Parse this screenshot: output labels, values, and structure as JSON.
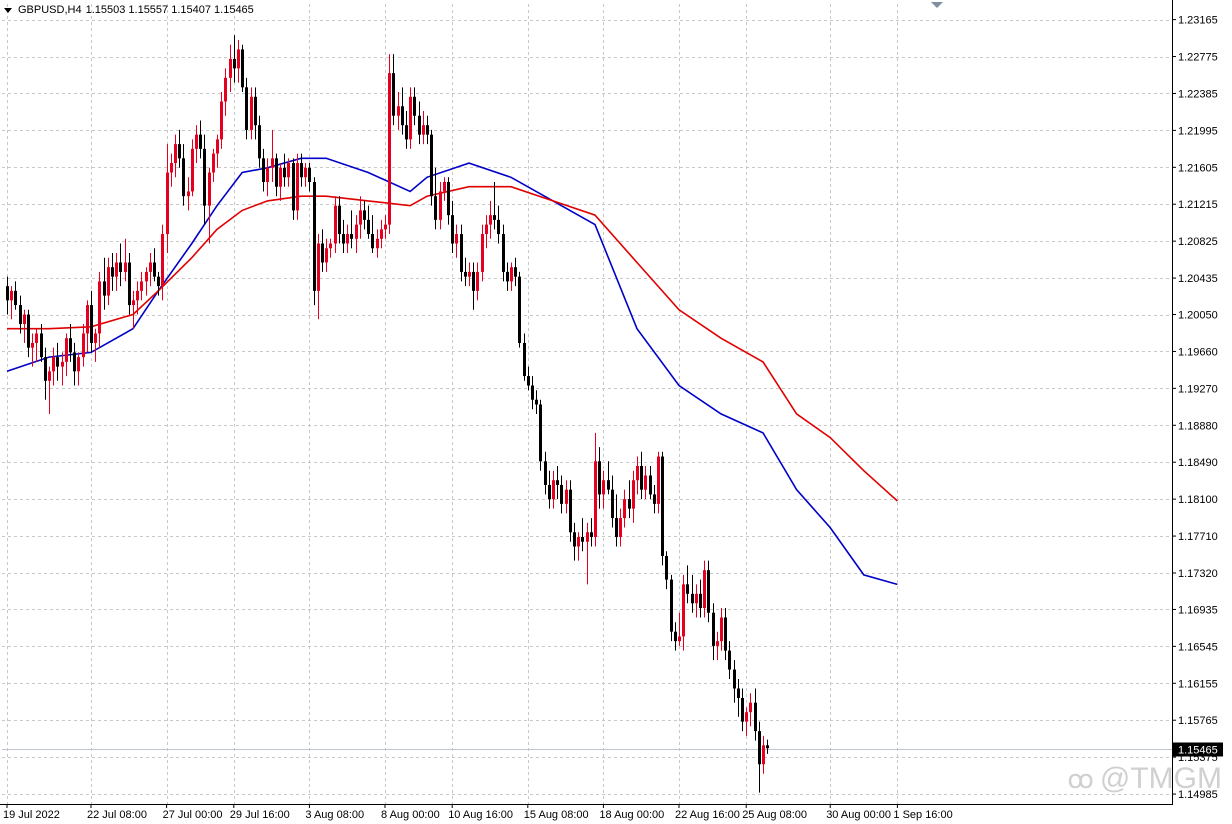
{
  "symbol_header": {
    "symbol": "GBPUSD,H4",
    "ohlc": "1.15503 1.15557 1.15407 1.15465"
  },
  "current_price_label": "1.15465",
  "watermark": {
    "icon": "tmgm-logo-icon",
    "text": "@TMGM"
  },
  "colors": {
    "bull": "#e6001f",
    "bear": "#000000",
    "ma_fast": "#0000c8",
    "ma_slow": "#e00000",
    "grid": "#c8c8c8",
    "price_line": "#bfc6d1"
  },
  "chart_data": {
    "type": "candlestick",
    "timeframe": "H4",
    "y_ticks": [
      1.23165,
      1.22775,
      1.22385,
      1.21995,
      1.21605,
      1.21215,
      1.20825,
      1.20435,
      1.2005,
      1.1966,
      1.1927,
      1.1888,
      1.1849,
      1.181,
      1.1771,
      1.1732,
      1.16935,
      1.16545,
      1.16155,
      1.15765,
      1.15375,
      1.14985
    ],
    "y_tick_labels": [
      "1.23165",
      "1.22775",
      "1.22385",
      "1.21995",
      "1.21605",
      "1.21215",
      "1.20825",
      "1.20435",
      "1.20050",
      "1.19660",
      "1.19270",
      "1.18880",
      "1.18490",
      "1.18100",
      "1.17710",
      "1.17320",
      "1.16935",
      "1.16545",
      "1.16155",
      "1.15765",
      "1.15375",
      "1.14985"
    ],
    "ylim": [
      1.1488,
      1.2333
    ],
    "x_labels": [
      {
        "label": "19 Jul 2022",
        "bar": 0
      },
      {
        "label": "22 Jul 08:00",
        "bar": 20
      },
      {
        "label": "27 Jul 00:00",
        "bar": 38
      },
      {
        "label": "29 Jul 16:00",
        "bar": 54
      },
      {
        "label": "3 Aug 08:00",
        "bar": 72
      },
      {
        "label": "8 Aug 00:00",
        "bar": 90
      },
      {
        "label": "10 Aug 16:00",
        "bar": 106
      },
      {
        "label": "15 Aug 08:00",
        "bar": 124
      },
      {
        "label": "18 Aug 00:00",
        "bar": 142
      },
      {
        "label": "22 Aug 16:00",
        "bar": 160
      },
      {
        "label": "25 Aug 08:00",
        "bar": 176
      },
      {
        "label": "30 Aug 00:00",
        "bar": 196
      },
      {
        "label": "1 Sep 16:00",
        "bar": 212
      }
    ],
    "grid": true,
    "last_price": 1.15465,
    "candles_ohlc": [
      [
        1.2035,
        1.2045,
        1.2005,
        1.202
      ],
      [
        1.202,
        1.2035,
        1.2,
        1.203
      ],
      [
        1.203,
        1.204,
        1.201,
        1.2015
      ],
      [
        1.2015,
        1.2025,
        1.1985,
        1.1995
      ],
      [
        1.1995,
        1.201,
        1.1975,
        1.2005
      ],
      [
        1.2005,
        1.201,
        1.196,
        1.197
      ],
      [
        1.197,
        1.1985,
        1.195,
        1.1975
      ],
      [
        1.1975,
        1.199,
        1.1955,
        1.1985
      ],
      [
        1.1985,
        1.1995,
        1.1955,
        1.196
      ],
      [
        1.196,
        1.197,
        1.1915,
        1.1935
      ],
      [
        1.1935,
        1.195,
        1.19,
        1.1945
      ],
      [
        1.1945,
        1.197,
        1.193,
        1.196
      ],
      [
        1.196,
        1.1975,
        1.1935,
        1.195
      ],
      [
        1.195,
        1.1965,
        1.193,
        1.1955
      ],
      [
        1.1955,
        1.1985,
        1.194,
        1.198
      ],
      [
        1.198,
        1.1995,
        1.1955,
        1.1965
      ],
      [
        1.1965,
        1.1975,
        1.193,
        1.1945
      ],
      [
        1.1945,
        1.1965,
        1.193,
        1.196
      ],
      [
        1.196,
        1.1995,
        1.195,
        1.1985
      ],
      [
        1.1985,
        1.202,
        1.1965,
        1.2015
      ],
      [
        1.2015,
        1.203,
        1.1965,
        1.1975
      ],
      [
        1.1975,
        1.199,
        1.1955,
        1.1985
      ],
      [
        1.1985,
        1.205,
        1.197,
        1.204
      ],
      [
        1.204,
        1.2065,
        1.201,
        1.2025
      ],
      [
        1.2025,
        1.2065,
        1.2015,
        1.2055
      ],
      [
        1.2055,
        1.207,
        1.203,
        1.2045
      ],
      [
        1.2045,
        1.207,
        1.203,
        1.206
      ],
      [
        1.206,
        1.208,
        1.2035,
        1.205
      ],
      [
        1.205,
        1.2085,
        1.204,
        1.206
      ],
      [
        1.206,
        1.207,
        1.2005,
        1.2015
      ],
      [
        1.2015,
        1.203,
        1.199,
        1.202
      ],
      [
        1.202,
        1.204,
        1.2005,
        1.203
      ],
      [
        1.203,
        1.205,
        1.202,
        1.204
      ],
      [
        1.204,
        1.2055,
        1.2025,
        1.205
      ],
      [
        1.205,
        1.207,
        1.2035,
        1.206
      ],
      [
        1.206,
        1.2075,
        1.204,
        1.2045
      ],
      [
        1.2045,
        1.205,
        1.2025,
        1.2035
      ],
      [
        1.2035,
        1.21,
        1.202,
        1.209
      ],
      [
        1.209,
        1.2185,
        1.207,
        1.2155
      ],
      [
        1.2155,
        1.2175,
        1.214,
        1.2165
      ],
      [
        1.2165,
        1.2195,
        1.215,
        1.2185
      ],
      [
        1.2185,
        1.22,
        1.216,
        1.217
      ],
      [
        1.217,
        1.2185,
        1.212,
        1.213
      ],
      [
        1.213,
        1.215,
        1.2115,
        1.2135
      ],
      [
        1.2135,
        1.219,
        1.213,
        1.218
      ],
      [
        1.218,
        1.2205,
        1.2165,
        1.2195
      ],
      [
        1.2195,
        1.221,
        1.217,
        1.218
      ],
      [
        1.218,
        1.2195,
        1.21,
        1.212
      ],
      [
        1.212,
        1.216,
        1.208,
        1.2155
      ],
      [
        1.2155,
        1.218,
        1.2145,
        1.2175
      ],
      [
        1.2175,
        1.2195,
        1.216,
        1.219
      ],
      [
        1.219,
        1.224,
        1.218,
        1.223
      ],
      [
        1.223,
        1.2265,
        1.2215,
        1.2255
      ],
      [
        1.2255,
        1.229,
        1.224,
        1.2275
      ],
      [
        1.2275,
        1.23,
        1.225,
        1.2265
      ],
      [
        1.2265,
        1.2295,
        1.225,
        1.2285
      ],
      [
        1.2285,
        1.229,
        1.224,
        1.2245
      ],
      [
        1.2245,
        1.2255,
        1.219,
        1.22
      ],
      [
        1.22,
        1.2245,
        1.219,
        1.2235
      ],
      [
        1.2235,
        1.2245,
        1.219,
        1.2205
      ],
      [
        1.2205,
        1.2215,
        1.216,
        1.217
      ],
      [
        1.217,
        1.218,
        1.2135,
        1.2145
      ],
      [
        1.2145,
        1.217,
        1.213,
        1.216
      ],
      [
        1.216,
        1.22,
        1.2145,
        1.217
      ],
      [
        1.217,
        1.2175,
        1.213,
        1.214
      ],
      [
        1.214,
        1.2165,
        1.2125,
        1.216
      ],
      [
        1.216,
        1.2175,
        1.214,
        1.215
      ],
      [
        1.215,
        1.217,
        1.214,
        1.2165
      ],
      [
        1.2165,
        1.217,
        1.2105,
        1.2115
      ],
      [
        1.2115,
        1.2175,
        1.2105,
        1.2165
      ],
      [
        1.2165,
        1.2175,
        1.214,
        1.215
      ],
      [
        1.215,
        1.2165,
        1.214,
        1.216
      ],
      [
        1.216,
        1.2165,
        1.2135,
        1.2145
      ],
      [
        1.2145,
        1.215,
        1.2015,
        1.203
      ],
      [
        1.203,
        1.209,
        1.2,
        1.208
      ],
      [
        1.208,
        1.2095,
        1.205,
        1.206
      ],
      [
        1.206,
        1.2085,
        1.205,
        1.2075
      ],
      [
        1.2075,
        1.2085,
        1.2065,
        1.208
      ],
      [
        1.208,
        1.213,
        1.207,
        1.212
      ],
      [
        1.212,
        1.213,
        1.208,
        1.209
      ],
      [
        1.209,
        1.2105,
        1.207,
        1.208
      ],
      [
        1.208,
        1.21,
        1.207,
        1.209
      ],
      [
        1.209,
        1.2115,
        1.2075,
        1.2085
      ],
      [
        1.2085,
        1.211,
        1.207,
        1.21
      ],
      [
        1.21,
        1.213,
        1.2085,
        1.2115
      ],
      [
        1.2115,
        1.2125,
        1.2095,
        1.2105
      ],
      [
        1.2105,
        1.212,
        1.2085,
        1.209
      ],
      [
        1.209,
        1.211,
        1.207,
        1.2075
      ],
      [
        1.2075,
        1.2095,
        1.2065,
        1.2085
      ],
      [
        1.2085,
        1.2105,
        1.2075,
        1.2095
      ],
      [
        1.2095,
        1.211,
        1.2085,
        1.21
      ],
      [
        1.21,
        1.228,
        1.209,
        1.226
      ],
      [
        1.226,
        1.228,
        1.2205,
        1.2215
      ],
      [
        1.2215,
        1.224,
        1.22,
        1.2225
      ],
      [
        1.2225,
        1.2245,
        1.2195,
        1.2205
      ],
      [
        1.2205,
        1.222,
        1.218,
        1.219
      ],
      [
        1.219,
        1.2245,
        1.218,
        1.2235
      ],
      [
        1.2235,
        1.2245,
        1.2205,
        1.2215
      ],
      [
        1.2215,
        1.223,
        1.2185,
        1.2195
      ],
      [
        1.2195,
        1.222,
        1.2185,
        1.2205
      ],
      [
        1.2205,
        1.2215,
        1.2185,
        1.2195
      ],
      [
        1.2195,
        1.22,
        1.212,
        1.213
      ],
      [
        1.213,
        1.216,
        1.2095,
        1.2105
      ],
      [
        1.2105,
        1.2145,
        1.2095,
        1.2135
      ],
      [
        1.2135,
        1.215,
        1.2125,
        1.2145
      ],
      [
        1.2145,
        1.215,
        1.21,
        1.211
      ],
      [
        1.211,
        1.2125,
        1.207,
        1.208
      ],
      [
        1.208,
        1.21,
        1.2065,
        1.209
      ],
      [
        1.209,
        1.21,
        1.204,
        1.205
      ],
      [
        1.205,
        1.2065,
        1.2035,
        1.2045
      ],
      [
        1.2045,
        1.206,
        1.2035,
        1.205
      ],
      [
        1.205,
        1.206,
        1.201,
        1.203
      ],
      [
        1.203,
        1.206,
        1.202,
        1.205
      ],
      [
        1.205,
        1.21,
        1.204,
        1.209
      ],
      [
        1.209,
        1.211,
        1.2075,
        1.21
      ],
      [
        1.21,
        1.2125,
        1.2085,
        1.211
      ],
      [
        1.211,
        1.2145,
        1.2095,
        1.2105
      ],
      [
        1.2105,
        1.212,
        1.208,
        1.209
      ],
      [
        1.209,
        1.21,
        1.204,
        1.205
      ],
      [
        1.205,
        1.206,
        1.203,
        1.204
      ],
      [
        1.204,
        1.206,
        1.203,
        1.2055
      ],
      [
        1.2055,
        1.2065,
        1.2035,
        1.2045
      ],
      [
        1.2045,
        1.205,
        1.197,
        1.1975
      ],
      [
        1.1975,
        1.1985,
        1.1935,
        1.194
      ],
      [
        1.194,
        1.195,
        1.1925,
        1.193
      ],
      [
        1.193,
        1.194,
        1.1905,
        1.1915
      ],
      [
        1.1915,
        1.1925,
        1.19,
        1.191
      ],
      [
        1.191,
        1.1915,
        1.184,
        1.185
      ],
      [
        1.185,
        1.186,
        1.1815,
        1.1825
      ],
      [
        1.1825,
        1.184,
        1.18,
        1.181
      ],
      [
        1.181,
        1.184,
        1.18,
        1.183
      ],
      [
        1.183,
        1.1845,
        1.181,
        1.1825
      ],
      [
        1.1825,
        1.1835,
        1.1795,
        1.1805
      ],
      [
        1.1805,
        1.183,
        1.1795,
        1.182
      ],
      [
        1.182,
        1.183,
        1.1765,
        1.1775
      ],
      [
        1.1775,
        1.1785,
        1.1745,
        1.176
      ],
      [
        1.176,
        1.1775,
        1.1745,
        1.177
      ],
      [
        1.177,
        1.179,
        1.1755,
        1.1765
      ],
      [
        1.1765,
        1.1785,
        1.172,
        1.1775
      ],
      [
        1.1775,
        1.179,
        1.176,
        1.177
      ],
      [
        1.177,
        1.188,
        1.176,
        1.185
      ],
      [
        1.185,
        1.1865,
        1.18,
        1.1815
      ],
      [
        1.1815,
        1.184,
        1.18,
        1.183
      ],
      [
        1.183,
        1.185,
        1.1815,
        1.182
      ],
      [
        1.182,
        1.1835,
        1.178,
        1.179
      ],
      [
        1.179,
        1.1815,
        1.176,
        1.177
      ],
      [
        1.177,
        1.18,
        1.176,
        1.179
      ],
      [
        1.179,
        1.182,
        1.178,
        1.181
      ],
      [
        1.181,
        1.183,
        1.179,
        1.18
      ],
      [
        1.18,
        1.184,
        1.1785,
        1.183
      ],
      [
        1.183,
        1.1855,
        1.1815,
        1.1845
      ],
      [
        1.1845,
        1.186,
        1.181,
        1.182
      ],
      [
        1.182,
        1.1845,
        1.181,
        1.1835
      ],
      [
        1.1835,
        1.1845,
        1.181,
        1.1815
      ],
      [
        1.1815,
        1.1825,
        1.1795,
        1.1805
      ],
      [
        1.1805,
        1.186,
        1.1795,
        1.1855
      ],
      [
        1.1855,
        1.186,
        1.174,
        1.175
      ],
      [
        1.175,
        1.1755,
        1.1715,
        1.1725
      ],
      [
        1.1725,
        1.173,
        1.166,
        1.167
      ],
      [
        1.167,
        1.168,
        1.165,
        1.166
      ],
      [
        1.166,
        1.169,
        1.1655,
        1.1665
      ],
      [
        1.1665,
        1.173,
        1.165,
        1.172
      ],
      [
        1.172,
        1.174,
        1.17,
        1.171
      ],
      [
        1.171,
        1.173,
        1.169,
        1.17
      ],
      [
        1.17,
        1.172,
        1.1685,
        1.171
      ],
      [
        1.171,
        1.1725,
        1.1685,
        1.1695
      ],
      [
        1.1695,
        1.1745,
        1.1685,
        1.1735
      ],
      [
        1.1735,
        1.1745,
        1.168,
        1.169
      ],
      [
        1.169,
        1.17,
        1.164,
        1.1655
      ],
      [
        1.1655,
        1.167,
        1.164,
        1.166
      ],
      [
        1.166,
        1.1695,
        1.165,
        1.1685
      ],
      [
        1.1685,
        1.1695,
        1.164,
        1.165
      ],
      [
        1.165,
        1.166,
        1.162,
        1.163
      ],
      [
        1.163,
        1.164,
        1.1595,
        1.161
      ],
      [
        1.161,
        1.162,
        1.158,
        1.16
      ],
      [
        1.16,
        1.161,
        1.1565,
        1.1575
      ],
      [
        1.1575,
        1.159,
        1.156,
        1.1585
      ],
      [
        1.1585,
        1.1605,
        1.157,
        1.1595
      ],
      [
        1.1595,
        1.161,
        1.1555,
        1.1565
      ],
      [
        1.1565,
        1.1575,
        1.15,
        1.153
      ],
      [
        1.153,
        1.156,
        1.152,
        1.155
      ],
      [
        1.155,
        1.1556,
        1.1541,
        1.1547
      ]
    ],
    "series": [
      {
        "name": "",
        "type": "line",
        "color": "#0000c8",
        "x": [
          0,
          10,
          20,
          30,
          36,
          44,
          50,
          56,
          62,
          70,
          76,
          86,
          96,
          100,
          110,
          120,
          130,
          140,
          150,
          160,
          170,
          180,
          188,
          196,
          204,
          212
        ],
        "values": [
          1.1945,
          1.196,
          1.1965,
          1.199,
          1.203,
          1.208,
          1.212,
          1.2155,
          1.216,
          1.217,
          1.217,
          1.2155,
          1.2135,
          1.215,
          1.2165,
          1.215,
          1.2125,
          1.21,
          1.199,
          1.193,
          1.19,
          1.188,
          1.182,
          1.178,
          1.173,
          1.172
        ]
      },
      {
        "name": "",
        "type": "line",
        "color": "#e00000",
        "x": [
          0,
          10,
          20,
          30,
          36,
          44,
          50,
          56,
          62,
          70,
          76,
          86,
          96,
          100,
          110,
          120,
          130,
          140,
          150,
          160,
          170,
          180,
          188,
          196,
          204,
          212
        ],
        "values": [
          1.199,
          1.199,
          1.1992,
          1.2005,
          1.203,
          1.2065,
          1.2095,
          1.2115,
          1.2125,
          1.213,
          1.213,
          1.2125,
          1.212,
          1.213,
          1.214,
          1.214,
          1.2125,
          1.211,
          1.206,
          1.201,
          1.198,
          1.1955,
          1.19,
          1.1875,
          1.184,
          1.1808
        ]
      }
    ]
  }
}
